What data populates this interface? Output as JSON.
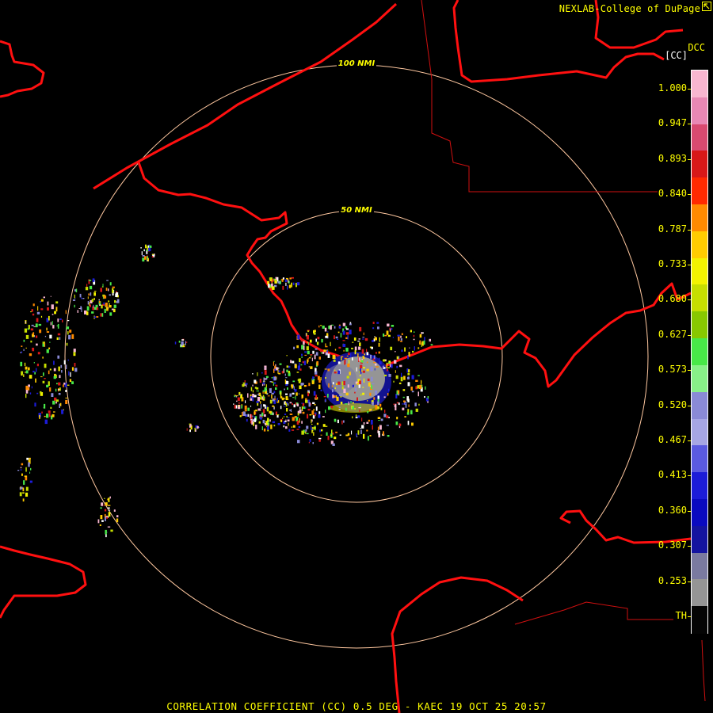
{
  "credit": "NEXLAB-College of DuPage",
  "credit_icon": "cursor-arrow-icon",
  "product_label": "DCC",
  "unit_label": "[CC]",
  "range_rings": [
    {
      "label": "50 NMI"
    },
    {
      "label": "100 NMI"
    }
  ],
  "legend_ticks": [
    "1.000",
    "0.947",
    "0.893",
    "0.840",
    "0.787",
    "0.733",
    "0.680",
    "0.627",
    "0.573",
    "0.520",
    "0.467",
    "0.413",
    "0.360",
    "0.307",
    "0.253",
    "TH"
  ],
  "legend_colors": [
    "#f8b6d0",
    "#e888b4",
    "#d84a70",
    "#d81818",
    "#ff2a00",
    "#ff8a00",
    "#ffcc00",
    "#f2f200",
    "#c6de00",
    "#88c800",
    "#48e848",
    "#88f088",
    "#8a8ad6",
    "#a6a6e4",
    "#5a5ae0",
    "#1c1cd8",
    "#0a0ac0",
    "#1414a0",
    "#7a7aa0",
    "#959595",
    "#050505"
  ],
  "colors": {
    "background": "#000000",
    "coastline": "#ff1010",
    "range_ring": "#ffc8a0",
    "text": "#ffff00"
  },
  "footer": "CORRELATION COEFFICIENT (CC) 0.5 DEG - KAEC 19 OCT 25 20:57"
}
